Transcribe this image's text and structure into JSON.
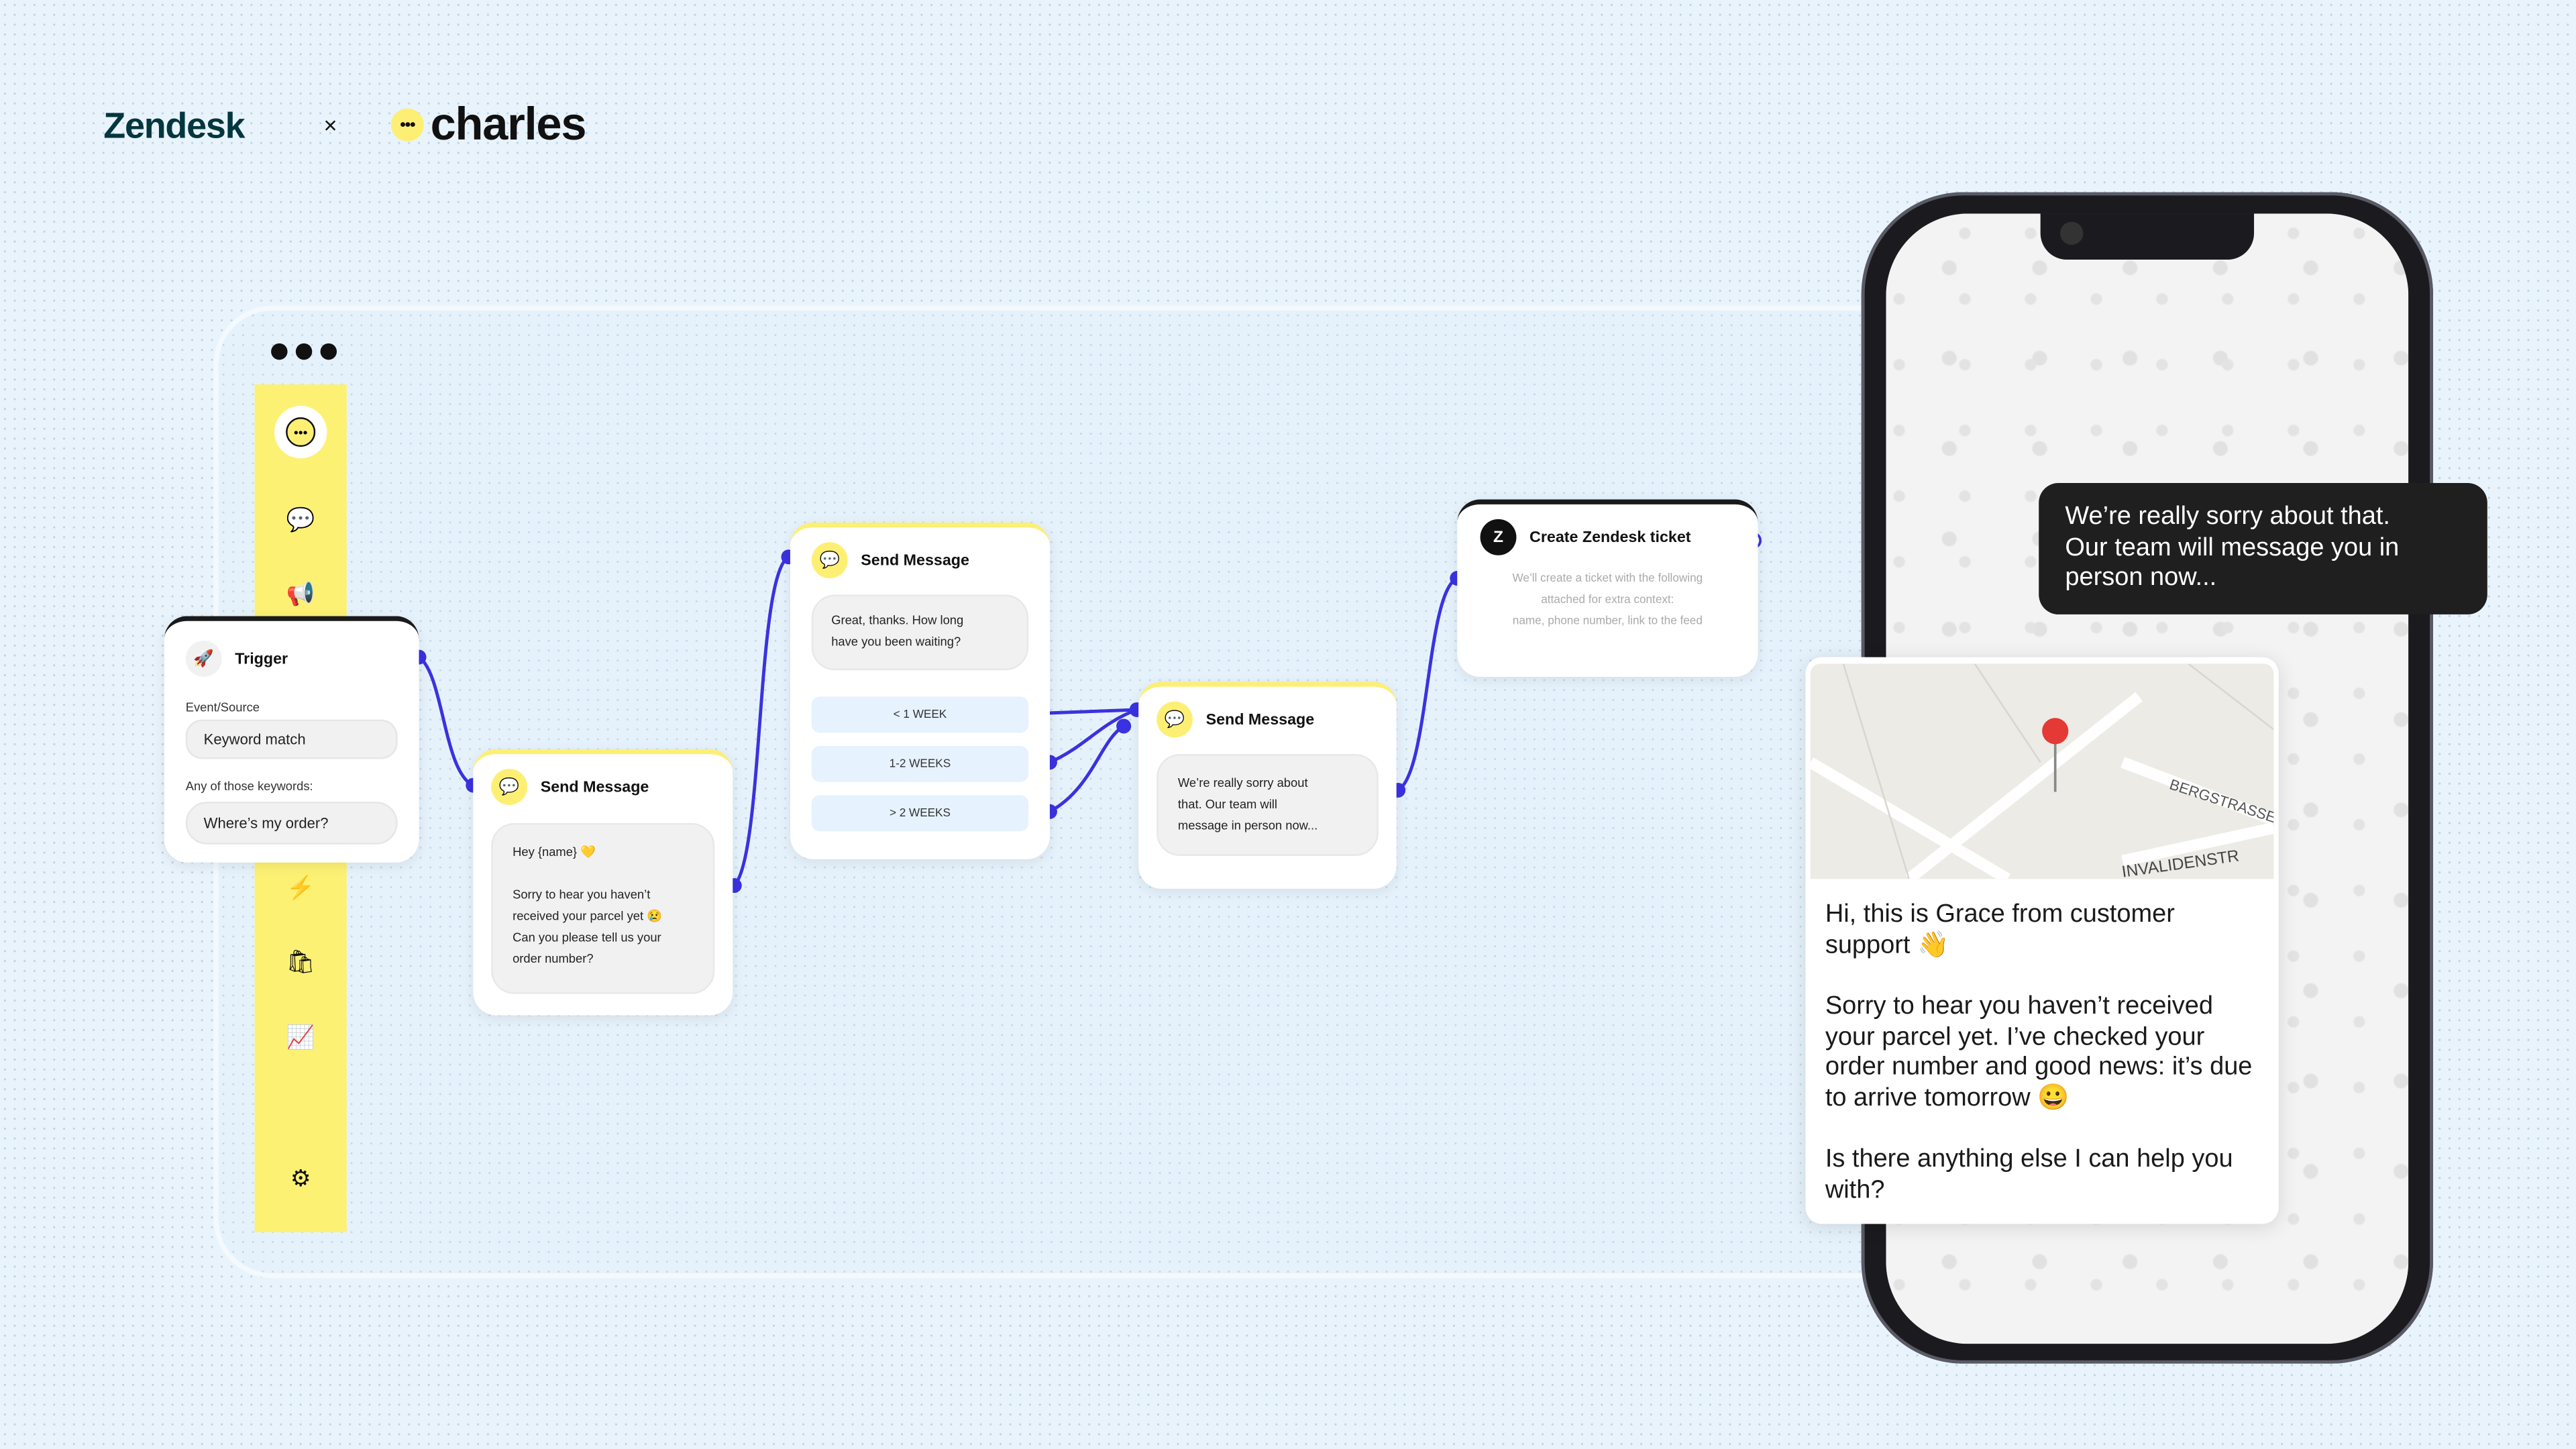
{
  "header": {
    "brand_left": "Zendesk",
    "separator": "×",
    "brand_right": "charles"
  },
  "colors": {
    "accent": "#3a32e0",
    "sidebar_yellow": "#fdf174",
    "dark": "#1a1a1a"
  },
  "sidebar": {
    "icons": [
      "charles-logo-icon",
      "chat-bubbles-icon",
      "broadcast-icon",
      "lightning-chat-icon",
      "shopping-bag-icon",
      "analytics-icon",
      "gear-icon"
    ]
  },
  "trigger": {
    "title": "Trigger",
    "event_label": "Event/Source",
    "event_value": "Keyword match",
    "keywords_label": "Any of those keywords:",
    "keywords_value": "Where’s my order?"
  },
  "send1": {
    "title": "Send Message",
    "lines": [
      "Hey {name} 💛",
      "Sorry to hear you haven’t",
      "received your parcel yet 😢",
      "Can you please tell us your",
      "order number?"
    ]
  },
  "send2": {
    "title": "Send Message",
    "text_lines": [
      "Great, thanks. How long",
      "have you been waiting?"
    ],
    "options": [
      "< 1 WEEK",
      "1-2 WEEKS",
      "> 2 WEEKS"
    ]
  },
  "send3": {
    "title": "Send Message",
    "lines": [
      "We’re really sorry about",
      "that. Our team will",
      "message in person now..."
    ]
  },
  "zendesk": {
    "title": "Create Zendesk ticket",
    "lines": [
      "We’ll create a ticket with the following",
      "attached for extra context:",
      "name, phone number, link to the feed"
    ]
  },
  "phone": {
    "bubble_lines": [
      "We’re really sorry about that.",
      "Our team will message you in",
      "person now..."
    ],
    "map_labels": [
      "BERGSTRASSE",
      "INVALIDENSTR"
    ],
    "message": [
      "Hi, this is Grace from customer support 👋",
      "Sorry to hear you haven’t received your parcel yet. I’ve checked your order number and good news: it’s due to arrive tomorrow 😀",
      "Is there anything else I can help you with?"
    ]
  }
}
